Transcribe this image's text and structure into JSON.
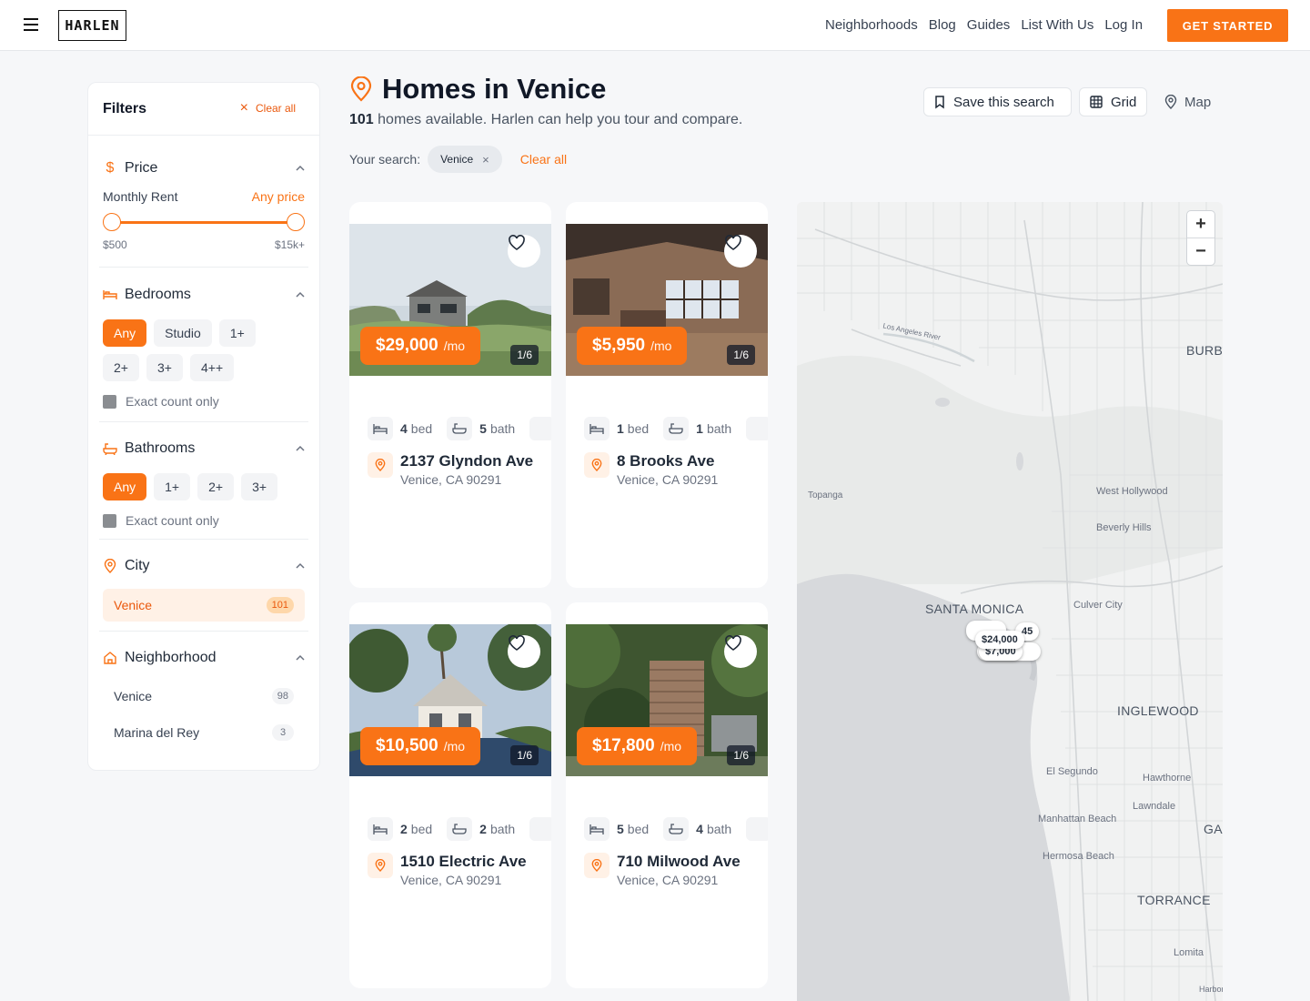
{
  "header": {
    "logo": "HARLEN",
    "nav": [
      "Neighborhoods",
      "Blog",
      "Guides",
      "List With Us",
      "Log In"
    ],
    "cta": "GET STARTED"
  },
  "filters": {
    "title": "Filters",
    "clear_all": "Clear all",
    "price": {
      "title": "Price",
      "monthly_rent_label": "Monthly Rent",
      "monthly_rent_value": "Any price",
      "min_label": "$500",
      "max_label": "$15k+"
    },
    "bedrooms": {
      "title": "Bedrooms",
      "options": [
        "Any",
        "Studio",
        "1+",
        "2+",
        "3+",
        "4++"
      ],
      "selected": "Any",
      "exact": "Exact count only"
    },
    "bathrooms": {
      "title": "Bathrooms",
      "options": [
        "Any",
        "1+",
        "2+",
        "3+"
      ],
      "selected": "Any",
      "exact": "Exact count only"
    },
    "city": {
      "title": "City",
      "items": [
        {
          "name": "Venice",
          "count": "101"
        }
      ]
    },
    "neighborhood": {
      "title": "Neighborhood",
      "items": [
        {
          "name": "Venice",
          "count": "98"
        },
        {
          "name": "Marina del Rey",
          "count": "3"
        }
      ]
    }
  },
  "main": {
    "title": "Homes in Venice",
    "count": "101",
    "subtitle_rest": "homes available. Harlen can help you tour and compare.",
    "your_search_label": "Your search:",
    "search_chip": "Venice",
    "clear_all": "Clear all",
    "save_search": "Save this search",
    "view_grid": "Grid",
    "view_map": "Map"
  },
  "listings": [
    {
      "price": "$29,000",
      "unit": "/mo",
      "photo_counter": "1/6",
      "beds": "4",
      "bed_label": "bed",
      "baths": "5",
      "bath_label": "bath",
      "street": "2137 Glyndon Ave",
      "city": "Venice, CA 90291"
    },
    {
      "price": "$5,950",
      "unit": "/mo",
      "photo_counter": "1/6",
      "beds": "1",
      "bed_label": "bed",
      "baths": "1",
      "bath_label": "bath",
      "street": "8 Brooks Ave",
      "city": "Venice, CA 90291"
    },
    {
      "price": "$10,500",
      "unit": "/mo",
      "photo_counter": "1/6",
      "beds": "2",
      "bed_label": "bed",
      "baths": "2",
      "bath_label": "bath",
      "street": "1510 Electric Ave",
      "city": "Venice, CA 90291"
    },
    {
      "price": "$17,800",
      "unit": "/mo",
      "photo_counter": "1/6",
      "beds": "5",
      "bed_label": "bed",
      "baths": "4",
      "bath_label": "bath",
      "street": "710 Milwood Ave",
      "city": "Venice, CA 90291"
    }
  ],
  "map": {
    "zoom_in": "+",
    "zoom_out": "−",
    "labels": [
      "BURB",
      "Topanga",
      "West Hollywood",
      "Beverly Hills",
      "SANTA MONICA",
      "Culver City",
      "INGLEWOOD",
      "El Segundo",
      "Hawthorne",
      "Lawndale",
      "Manhattan Beach",
      "GA",
      "Hermosa Beach",
      "TORRANCE",
      "Lomita",
      "Harbor Hi",
      "Los Angeles River"
    ],
    "pins": [
      "$24,000",
      "$7,000",
      "45"
    ]
  },
  "colors": {
    "accent": "#f97316",
    "accent_dark": "#ea580c",
    "text": "#1f2937"
  }
}
